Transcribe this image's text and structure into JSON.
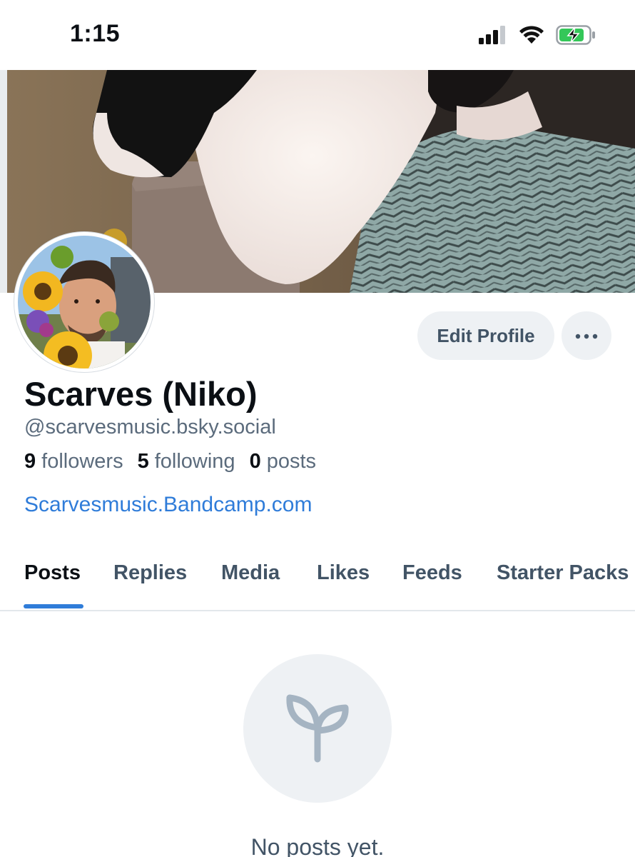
{
  "status_bar": {
    "time": "1:15",
    "icons": [
      "cellular-signal-icon",
      "wifi-icon",
      "battery-charging-icon"
    ]
  },
  "profile": {
    "display_name": "Scarves (Niko)",
    "handle": "@scarvesmusic.bsky.social",
    "followers_count": "9",
    "followers_label": "followers",
    "following_count": "5",
    "following_label": "following",
    "posts_count": "0",
    "posts_label": "posts",
    "link": "Scarvesmusic.Bandcamp.com"
  },
  "actions": {
    "edit_profile_label": "Edit Profile",
    "more_icon": "ellipsis-icon"
  },
  "tabs": [
    {
      "label": "Posts",
      "active": true
    },
    {
      "label": "Replies",
      "active": false
    },
    {
      "label": "Media",
      "active": false
    },
    {
      "label": "Likes",
      "active": false
    },
    {
      "label": "Feeds",
      "active": false
    },
    {
      "label": "Starter Packs",
      "active": false
    }
  ],
  "empty_state": {
    "icon": "seedling-icon",
    "message": "No posts yet."
  },
  "colors": {
    "accent": "#2f7cd9",
    "muted_text": "#5b6b7c",
    "button_bg": "#eef1f4"
  }
}
